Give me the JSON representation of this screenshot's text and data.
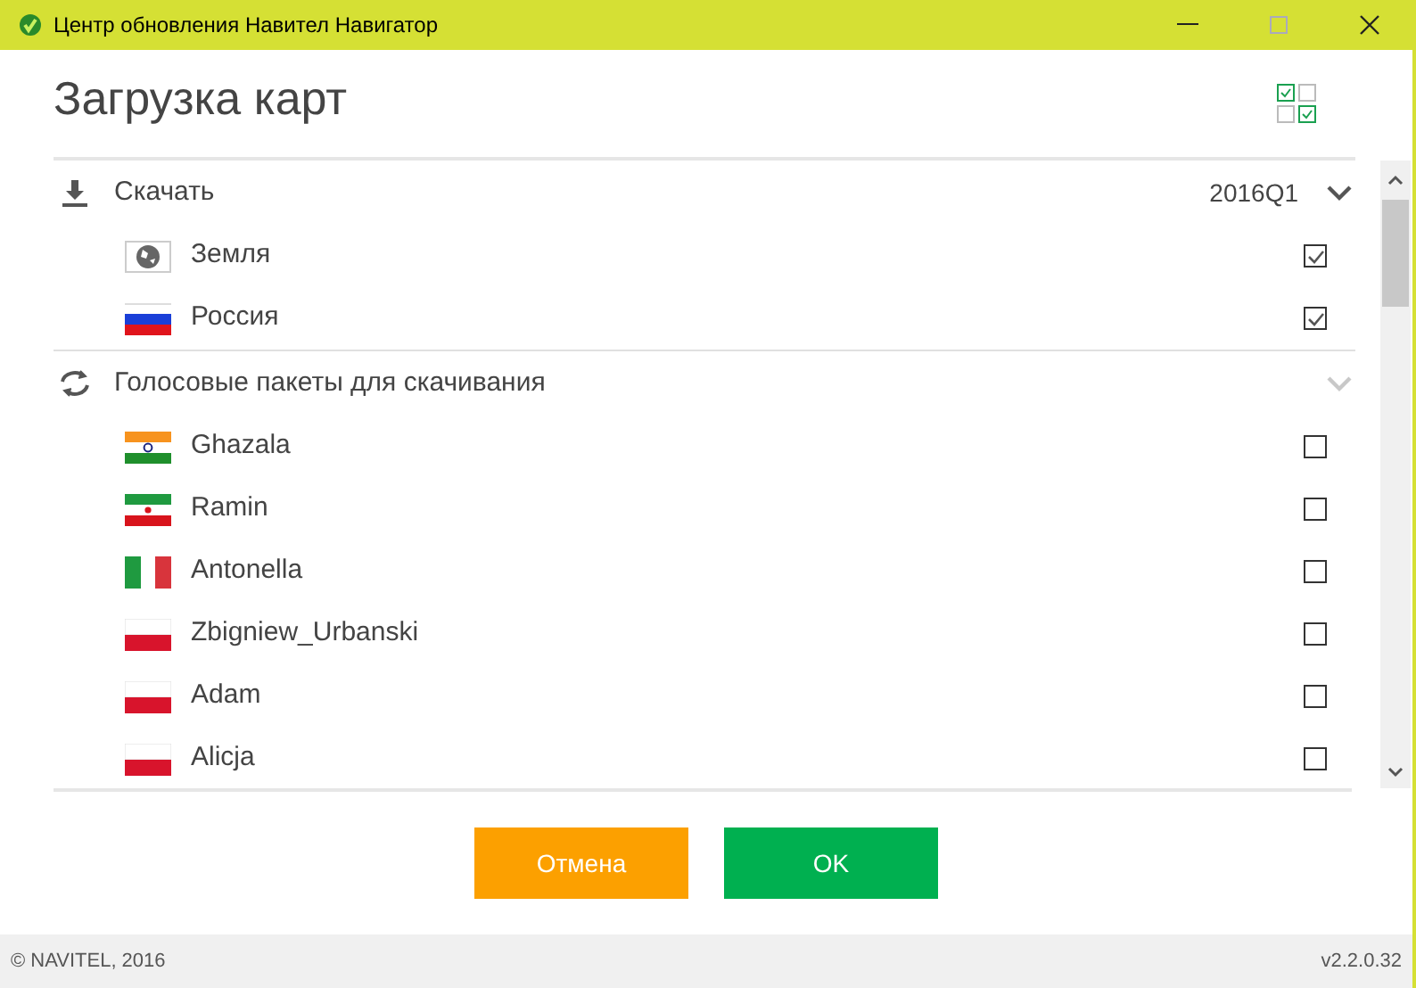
{
  "window": {
    "title": "Центр обновления Навител Навигатор"
  },
  "page_title": "Загрузка карт",
  "sections": [
    {
      "kind": "download",
      "label": "Скачать",
      "version": "2016Q1",
      "disabled": false,
      "items": [
        {
          "kind": "globe",
          "label": "Земля",
          "checked": true
        },
        {
          "kind": "russia",
          "label": "Россия",
          "checked": true
        }
      ]
    },
    {
      "kind": "sync",
      "label": "Голосовые пакеты для скачивания",
      "disabled": true,
      "items": [
        {
          "kind": "india",
          "label": "Ghazala",
          "checked": false
        },
        {
          "kind": "iran",
          "label": "Ramin",
          "checked": false
        },
        {
          "kind": "italy",
          "label": "Antonella",
          "checked": false
        },
        {
          "kind": "poland",
          "label": "Zbigniew_Urbanski",
          "checked": false
        },
        {
          "kind": "poland",
          "label": "Adam",
          "checked": false
        },
        {
          "kind": "poland",
          "label": "Alicja",
          "checked": false
        }
      ]
    }
  ],
  "buttons": [
    {
      "kind": "cancel",
      "label": "Отмена"
    },
    {
      "kind": "ok",
      "label": "OK"
    }
  ],
  "footer": {
    "copyright": "© NAVITEL, 2016",
    "version": "v2.2.0.32"
  }
}
